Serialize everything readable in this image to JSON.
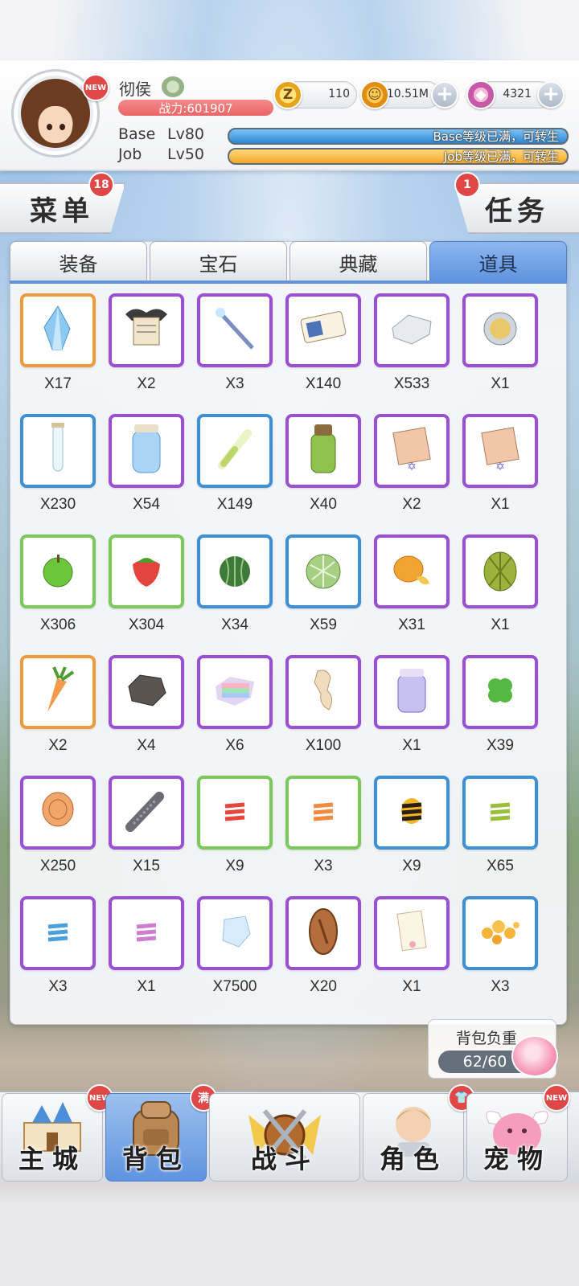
{
  "player": {
    "name": "彻侯",
    "power": "战力:601907",
    "base_label": "Base",
    "base_level": "Lv80",
    "base_status": "Base等级已满，可转生",
    "job_label": "Job",
    "job_level": "Lv50",
    "job_status": "Job等级已满，可转生",
    "avatar_badge": "NEW"
  },
  "currency": {
    "zeny": "110",
    "gold": "10.51M",
    "gem": "4321"
  },
  "menu": {
    "label": "菜单",
    "badge": "18"
  },
  "task": {
    "label": "任务",
    "badge": "1"
  },
  "tabs": [
    {
      "label": "装备",
      "active": false
    },
    {
      "label": "宝石",
      "active": false
    },
    {
      "label": "典藏",
      "active": false
    },
    {
      "label": "道具",
      "active": true
    }
  ],
  "items": [
    {
      "qty": "X17",
      "rarity": "orange",
      "icon": "blue-crystal-icon"
    },
    {
      "qty": "X2",
      "rarity": "purple",
      "icon": "bat-scroll-icon"
    },
    {
      "qty": "X3",
      "rarity": "purple",
      "icon": "ice-wand-icon"
    },
    {
      "qty": "X140",
      "rarity": "purple",
      "icon": "ticket-icon"
    },
    {
      "qty": "X533",
      "rarity": "purple",
      "icon": "silver-ingot-icon"
    },
    {
      "qty": "X1",
      "rarity": "purple",
      "icon": "coin-icon"
    },
    {
      "qty": "X230",
      "rarity": "blue",
      "icon": "test-tube-icon"
    },
    {
      "qty": "X54",
      "rarity": "purple",
      "icon": "water-jar-icon"
    },
    {
      "qty": "X149",
      "rarity": "blue",
      "icon": "green-vial-icon"
    },
    {
      "qty": "X40",
      "rarity": "purple",
      "icon": "green-potion-icon"
    },
    {
      "qty": "X2",
      "rarity": "purple",
      "icon": "card-pack-icon"
    },
    {
      "qty": "X1",
      "rarity": "purple",
      "icon": "card-pack-icon"
    },
    {
      "qty": "X306",
      "rarity": "green",
      "icon": "apple-icon"
    },
    {
      "qty": "X304",
      "rarity": "green",
      "icon": "strawberry-icon"
    },
    {
      "qty": "X34",
      "rarity": "blue",
      "icon": "watermelon-icon"
    },
    {
      "qty": "X59",
      "rarity": "blue",
      "icon": "melon-icon"
    },
    {
      "qty": "X31",
      "rarity": "purple",
      "icon": "mango-icon"
    },
    {
      "qty": "X1",
      "rarity": "purple",
      "icon": "durian-icon"
    },
    {
      "qty": "X2",
      "rarity": "orange",
      "icon": "carrot-icon"
    },
    {
      "qty": "X4",
      "rarity": "purple",
      "icon": "ore-icon"
    },
    {
      "qty": "X6",
      "rarity": "purple",
      "icon": "rainbow-gem-icon"
    },
    {
      "qty": "X100",
      "rarity": "purple",
      "icon": "bone-icon"
    },
    {
      "qty": "X1",
      "rarity": "purple",
      "icon": "jar-icon"
    },
    {
      "qty": "X39",
      "rarity": "purple",
      "icon": "clover-icon"
    },
    {
      "qty": "X250",
      "rarity": "purple",
      "icon": "bronze-coin-icon"
    },
    {
      "qty": "X15",
      "rarity": "purple",
      "icon": "key-icon"
    },
    {
      "qty": "X9",
      "rarity": "green",
      "icon": "red-candy-icon"
    },
    {
      "qty": "X3",
      "rarity": "green",
      "icon": "orange-candy-icon"
    },
    {
      "qty": "X9",
      "rarity": "blue",
      "icon": "bee-candy-icon"
    },
    {
      "qty": "X65",
      "rarity": "blue",
      "icon": "green-candy-icon"
    },
    {
      "qty": "X3",
      "rarity": "purple",
      "icon": "blue-candy-icon"
    },
    {
      "qty": "X1",
      "rarity": "purple",
      "icon": "pink-candy-icon"
    },
    {
      "qty": "X7500",
      "rarity": "purple",
      "icon": "ice-crystal-icon"
    },
    {
      "qty": "X20",
      "rarity": "purple",
      "icon": "copper-coin-icon"
    },
    {
      "qty": "X1",
      "rarity": "purple",
      "icon": "paper-scroll-icon"
    },
    {
      "qty": "X3",
      "rarity": "blue",
      "icon": "gold-nuggets-icon"
    }
  ],
  "weight": {
    "label": "背包负重",
    "value": "62/60"
  },
  "nav": [
    {
      "label": "主城",
      "badge": "NEW",
      "active": false
    },
    {
      "label": "背包",
      "badge": "满",
      "active": true
    },
    {
      "label": "战斗",
      "badge": "",
      "active": false
    },
    {
      "label": "角色",
      "badge": "",
      "active": false
    },
    {
      "label": "宠物",
      "badge": "NEW",
      "active": false
    }
  ]
}
